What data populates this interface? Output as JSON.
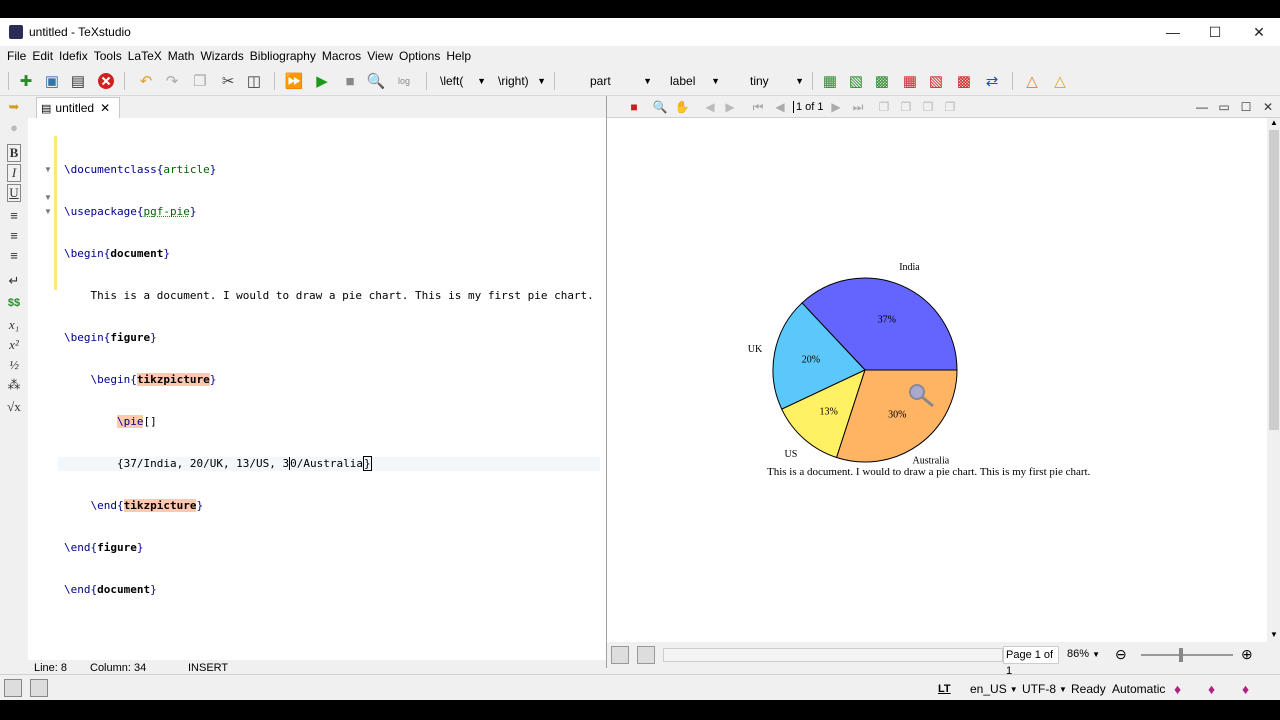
{
  "window": {
    "title": "untitled - TeXstudio"
  },
  "menu": [
    "File",
    "Edit",
    "Idefix",
    "Tools",
    "LaTeX",
    "Math",
    "Wizards",
    "Bibliography",
    "Macros",
    "View",
    "Options",
    "Help"
  ],
  "toolbar": {
    "left_combo": "\\left(",
    "right_combo": "\\right)",
    "part_combo": "part",
    "label_combo": "label",
    "size_combo": "tiny"
  },
  "editor": {
    "tab_label": "untitled",
    "lines": [
      "\\documentclass{article}",
      "\\usepackage{pgf-pie}",
      "\\begin{document}",
      "    This is a document. I would to draw a pie chart. This is my first pie chart.",
      "\\begin{figure}",
      "    \\begin{tikzpicture}",
      "        \\pie[]",
      "        {37/India, 20/UK, 13/US, 30/Australia}",
      "    \\end{tikzpicture}",
      "\\end{figure}",
      "\\end{document}"
    ],
    "status": {
      "line": "Line: 8",
      "column": "Column: 34",
      "mode": "INSERT"
    }
  },
  "pdf": {
    "page_box": "1 of 1",
    "page_label": "Page 1 of 1",
    "zoom": "86%",
    "caption": "This is a document. I would to draw a pie chart. This is my first pie chart."
  },
  "chart_data": {
    "type": "pie",
    "slices": [
      {
        "label": "India",
        "value": 37,
        "text": "37%",
        "color": "#6464ff"
      },
      {
        "label": "UK",
        "value": 20,
        "text": "20%",
        "color": "#5ac8fa"
      },
      {
        "label": "US",
        "value": 13,
        "text": "13%",
        "color": "#fff064"
      },
      {
        "label": "Australia",
        "value": 30,
        "text": "30%",
        "color": "#ffb464"
      }
    ]
  },
  "statusbar": {
    "lang": "en_US",
    "encoding": "UTF-8",
    "ready": "Ready",
    "automatic": "Automatic",
    "lt": "LT"
  }
}
